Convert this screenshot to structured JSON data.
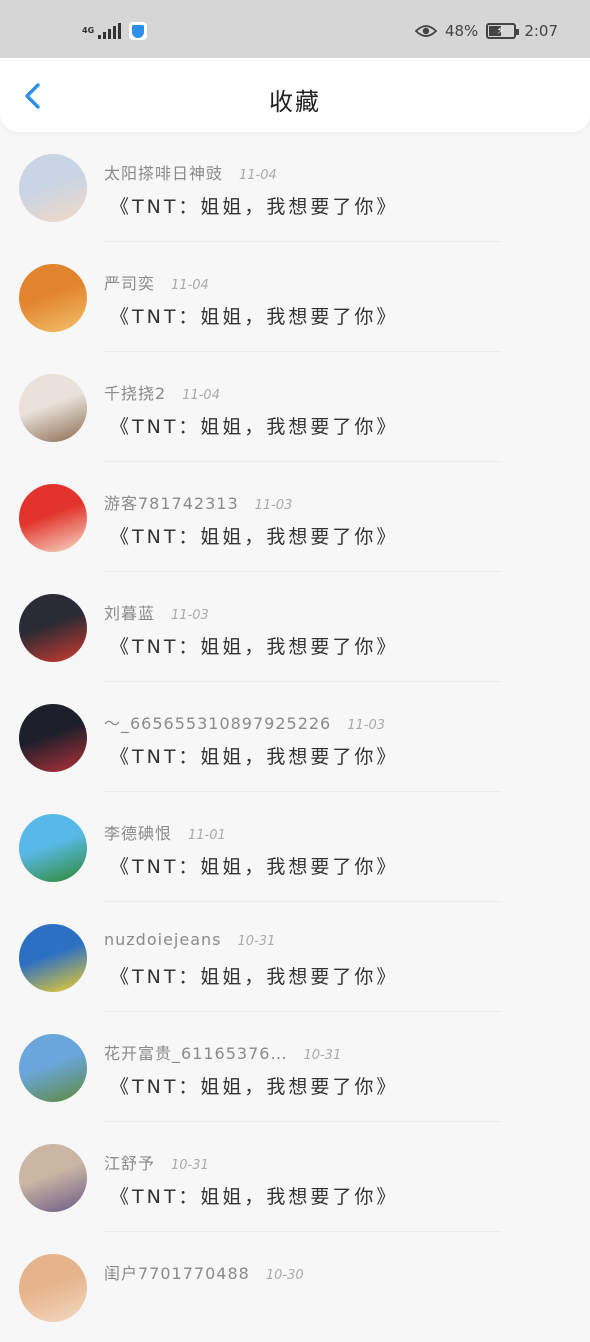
{
  "status_bar": {
    "network": "4G",
    "battery_percent": "48%",
    "time": "2:07"
  },
  "header": {
    "title": "收藏"
  },
  "items": [
    {
      "name": "太阳搽啡日神豉",
      "date": "11-04",
      "message": "《TNT：姐姐，我想要了你》"
    },
    {
      "name": "严司奕",
      "date": "11-04",
      "message": "《TNT：姐姐，我想要了你》"
    },
    {
      "name": "千挠挠2",
      "date": "11-04",
      "message": "《TNT：姐姐，我想要了你》"
    },
    {
      "name": "游客781742313",
      "date": "11-03",
      "message": "《TNT：姐姐，我想要了你》"
    },
    {
      "name": "刘暮蓝",
      "date": "11-03",
      "message": "《TNT：姐姐，我想要了你》"
    },
    {
      "name": "～_665655310897925226",
      "date": "11-03",
      "message": "《TNT：姐姐，我想要了你》"
    },
    {
      "name": "李德碘恨",
      "date": "11-01",
      "message": "《TNT：姐姐，我想要了你》"
    },
    {
      "name": "nuzdoiejeans",
      "date": "10-31",
      "message": "《TNT：姐姐，我想要了你》"
    },
    {
      "name": "花开富贵_61165376…",
      "date": "10-31",
      "message": "《TNT：姐姐，我想要了你》"
    },
    {
      "name": "江舒予",
      "date": "10-31",
      "message": "《TNT：姐姐，我想要了你》"
    },
    {
      "name": "闺户7701770488",
      "date": "10-30",
      "message": ""
    }
  ],
  "avatar_colors": [
    [
      "#c9d4e4",
      "#f1d9c6"
    ],
    [
      "#e2842e",
      "#f4c16a"
    ],
    [
      "#e9e2da",
      "#8a6a4e"
    ],
    [
      "#e2342c",
      "#f6dcc8"
    ],
    [
      "#2b2b33",
      "#d23a30"
    ],
    [
      "#1d1f2a",
      "#b7303a"
    ],
    [
      "#58b9e8",
      "#2f8a2f"
    ],
    [
      "#2c70c4",
      "#f2d02a"
    ],
    [
      "#6aa6dc",
      "#5e8a3a"
    ],
    [
      "#cbb6a4",
      "#6a5a86"
    ],
    [
      "#e6b48c",
      "#f3d9c2"
    ]
  ]
}
